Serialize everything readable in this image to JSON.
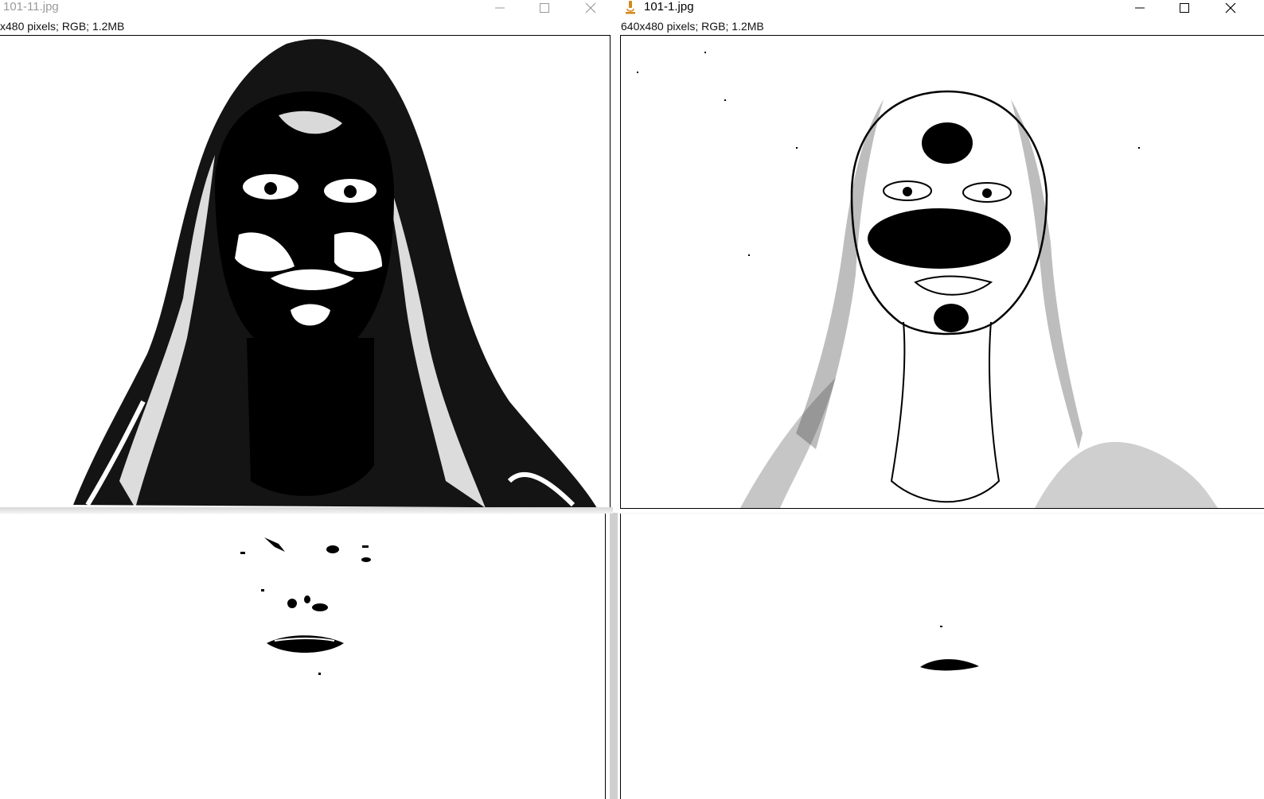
{
  "windows": [
    {
      "id": "left",
      "title": "101-11.jpg",
      "info": "x480 pixels; RGB; 1.2MB",
      "active": false,
      "controls": [
        "minimize-icon",
        "maximize-icon",
        "close-icon"
      ]
    },
    {
      "id": "right",
      "title": "101-1.jpg",
      "info": "640x480 pixels; RGB; 1.2MB",
      "active": true,
      "app_icon": "microscope-icon",
      "controls": [
        "minimize-icon",
        "maximize-icon",
        "close-icon"
      ]
    }
  ],
  "colors": {
    "title_inactive": "#9a9a9a",
    "title_active": "#000000",
    "app_icon": "#d4881c",
    "divider": "#cfcfcf"
  }
}
